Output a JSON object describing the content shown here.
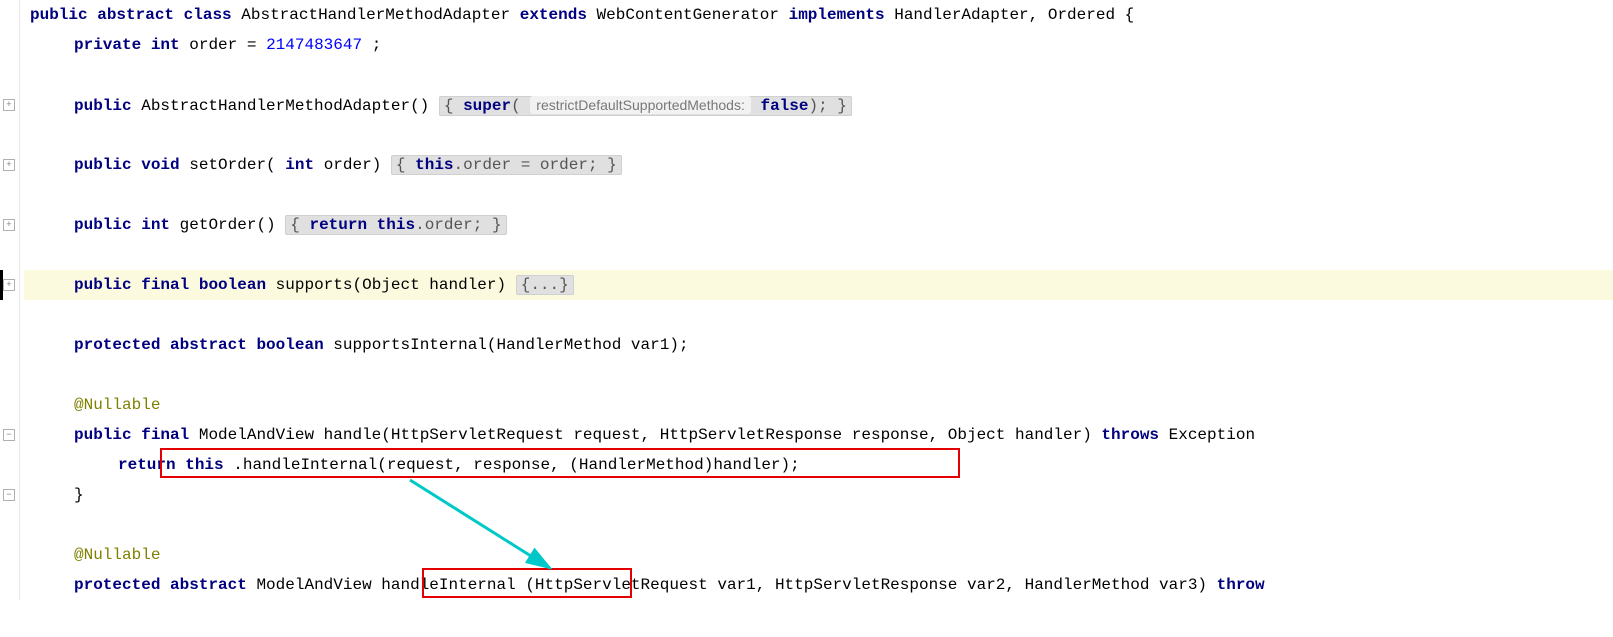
{
  "line1": {
    "kw_public": "public",
    "kw_abstract": "abstract",
    "kw_class": "class",
    "name": "AbstractHandlerMethodAdapter",
    "kw_extends": "extends",
    "super": "WebContentGenerator",
    "kw_implements": "implements",
    "impls": "HandlerAdapter, Ordered {"
  },
  "line2": {
    "kw_private": "private",
    "kw_int": "int",
    "decl": "order = ",
    "num": "2147483647",
    "semi": ";"
  },
  "line4": {
    "kw_public": "public",
    "ctor": "AbstractHandlerMethodAdapter()",
    "brace_open": " { ",
    "kw_super": "super",
    "paren_open": "( ",
    "hint": "restrictDefaultSupportedMethods:",
    "kw_false": " false",
    "close": "); ",
    "brace_close": "}"
  },
  "line6": {
    "kw_public": "public",
    "kw_void": "void",
    "sig": "setOrder(",
    "kw_int": "int",
    "sig2": " order)",
    "brace_open": " { ",
    "kw_this": "this",
    "body": ".order = order; ",
    "brace_close": "}"
  },
  "line8": {
    "kw_public": "public",
    "kw_int": "int",
    "sig": "getOrder()",
    "brace_open": " { ",
    "kw_return": "return",
    "kw_this": " this",
    "body": ".order; ",
    "brace_close": "}"
  },
  "line10": {
    "kw_public": "public",
    "kw_final": "final",
    "kw_boolean": "boolean",
    "sig": "supports(Object handler) ",
    "fold": "{...}"
  },
  "line12": {
    "kw_protected": "protected",
    "kw_abstract": "abstract",
    "kw_boolean": "boolean",
    "sig": "supportsInternal(HandlerMethod var1);"
  },
  "line14": {
    "ann": "@Nullable"
  },
  "line15": {
    "kw_public": "public",
    "kw_final": "final",
    "ret": "ModelAndView",
    "sig": "handle(HttpServletRequest request, HttpServletResponse response, Object handler)",
    "kw_throws": " throws",
    "exc": " Exception "
  },
  "line16": {
    "kw_return": "return ",
    "kw_this": "this",
    "body": ".handleInternal(request, response, (HandlerMethod)handler);"
  },
  "line17": {
    "brace": "}"
  },
  "line19": {
    "ann": "@Nullable"
  },
  "line20": {
    "kw_protected": "protected",
    "kw_abstract": "abstract",
    "ret": "ModelAndView ",
    "name": "handleInternal",
    "sig": "(HttpServletRequest var1, HttpServletResponse var2, HandlerMethod var3) ",
    "kw_throws": "throw"
  },
  "fold_plus": "+",
  "fold_minus": "−"
}
